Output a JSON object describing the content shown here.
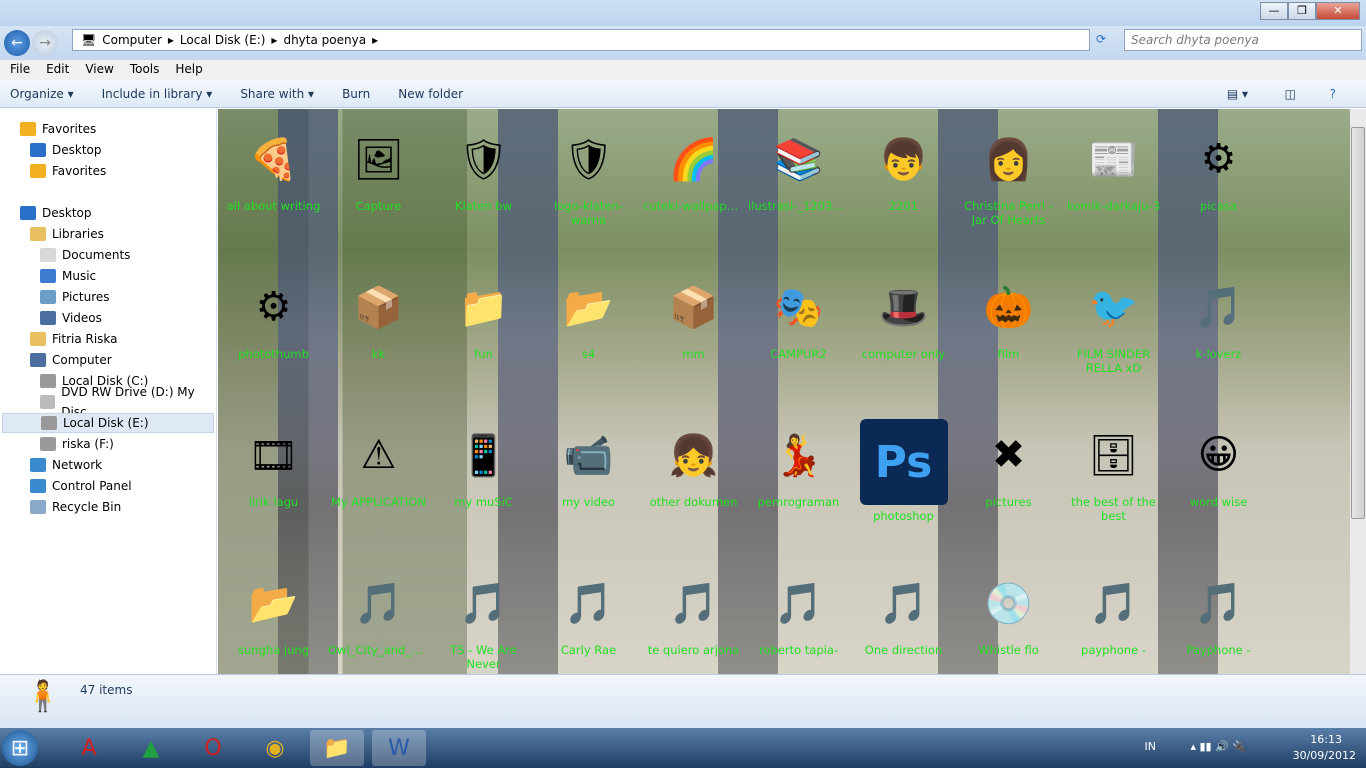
{
  "window": {
    "minimize": "—",
    "maximize": "❐",
    "close": "✕"
  },
  "address": {
    "segments": [
      "Computer",
      "Local Disk (E:)",
      "dhyta poenya"
    ],
    "search_placeholder": "Search dhyta poenya"
  },
  "menu": [
    "File",
    "Edit",
    "View",
    "Tools",
    "Help"
  ],
  "commands": [
    "Organize ▾",
    "Include in library ▾",
    "Share with ▾",
    "Burn",
    "New folder"
  ],
  "nav": [
    {
      "label": "Favorites",
      "indent": 0,
      "color": "#f0b020"
    },
    {
      "label": "Desktop",
      "indent": 1,
      "color": "#2a6fc9"
    },
    {
      "label": "Favorites",
      "indent": 1,
      "color": "#f0b020"
    },
    {
      "label": "Desktop",
      "indent": 0,
      "color": "#2a6fc9",
      "gap": true
    },
    {
      "label": "Libraries",
      "indent": 1,
      "color": "#e8c060"
    },
    {
      "label": "Documents",
      "indent": 2,
      "color": "#d8d8d8"
    },
    {
      "label": "Music",
      "indent": 2,
      "color": "#3b7bd0"
    },
    {
      "label": "Pictures",
      "indent": 2,
      "color": "#6aa0c8"
    },
    {
      "label": "Videos",
      "indent": 2,
      "color": "#4a6ea0"
    },
    {
      "label": "Fitria Riska",
      "indent": 1,
      "color": "#e8c060"
    },
    {
      "label": "Computer",
      "indent": 1,
      "color": "#4a6ea0"
    },
    {
      "label": "Local Disk (C:)",
      "indent": 2,
      "color": "#999"
    },
    {
      "label": "DVD RW Drive (D:) My Disc",
      "indent": 2,
      "color": "#bbb"
    },
    {
      "label": "Local Disk (E:)",
      "indent": 2,
      "color": "#999",
      "selected": true
    },
    {
      "label": "riska (F:)",
      "indent": 2,
      "color": "#999"
    },
    {
      "label": "Network",
      "indent": 1,
      "color": "#3a8ad0"
    },
    {
      "label": "Control Panel",
      "indent": 1,
      "color": "#3a8ad0"
    },
    {
      "label": "Recycle Bin",
      "indent": 1,
      "color": "#8aa8c8"
    }
  ],
  "items": [
    {
      "label": "all about writing",
      "icon": "🍕"
    },
    {
      "label": "Capture",
      "icon": "🖼"
    },
    {
      "label": "Klaten bw",
      "icon": "🛡"
    },
    {
      "label": "logo-klaten-warna",
      "icon": "🛡"
    },
    {
      "label": "cuteki-wallpaper...",
      "icon": "🌈"
    },
    {
      "label": "ilustrasi-_120319...",
      "icon": "📚"
    },
    {
      "label": "2201",
      "icon": "👦"
    },
    {
      "label": "Christina Perri - Jar Of Hearts",
      "icon": "👩"
    },
    {
      "label": "komik-darkaju-3",
      "icon": "📰"
    },
    {
      "label": "picasa",
      "icon": "⚙"
    },
    {
      "label": "photothumb",
      "icon": "⚙"
    },
    {
      "label": "kk",
      "icon": "📦"
    },
    {
      "label": "fun",
      "icon": "📁"
    },
    {
      "label": "s4",
      "icon": "📂"
    },
    {
      "label": "mm",
      "icon": "📦"
    },
    {
      "label": "CAMPUR2",
      "icon": "🎭"
    },
    {
      "label": "computer only",
      "icon": "🎩"
    },
    {
      "label": "film",
      "icon": "🎃"
    },
    {
      "label": "FILM SINDER RELLA xD",
      "icon": "🐦"
    },
    {
      "label": "k-loverz",
      "icon": "🎵"
    },
    {
      "label": "lirik lagu",
      "icon": "🎞"
    },
    {
      "label": "My APPLICATION",
      "icon": "⚠"
    },
    {
      "label": "my muSiC",
      "icon": "📱"
    },
    {
      "label": "my video",
      "icon": "📹"
    },
    {
      "label": "other dokumen",
      "icon": "👧"
    },
    {
      "label": "pemrograman",
      "icon": "💃"
    },
    {
      "label": "photoshop",
      "icon": "Ps"
    },
    {
      "label": "pictures",
      "icon": "✖"
    },
    {
      "label": "the best of the best",
      "icon": "🗄"
    },
    {
      "label": "word wise",
      "icon": "😀"
    },
    {
      "label": "sungha jung",
      "icon": "📂"
    },
    {
      "label": "Owl_City_and_Ca...",
      "icon": "🎵"
    },
    {
      "label": "TS - We Are Never",
      "icon": "🎵"
    },
    {
      "label": "Carly Rae",
      "icon": "🎵"
    },
    {
      "label": "te quiero arjona",
      "icon": "🎵"
    },
    {
      "label": "roberto tapia-",
      "icon": "🎵"
    },
    {
      "label": "One direction",
      "icon": "🎵"
    },
    {
      "label": "Whistle flo",
      "icon": "💿"
    },
    {
      "label": "payphone -",
      "icon": "🎵"
    },
    {
      "label": "Payphone -",
      "icon": "🎵"
    }
  ],
  "status": {
    "count": "47 items"
  },
  "taskbar": {
    "apps": [
      "⊞",
      "A",
      "▲",
      "O",
      "◉",
      "📁",
      "W"
    ],
    "lang": "IN",
    "time": "16:13",
    "date": "30/09/2012"
  }
}
